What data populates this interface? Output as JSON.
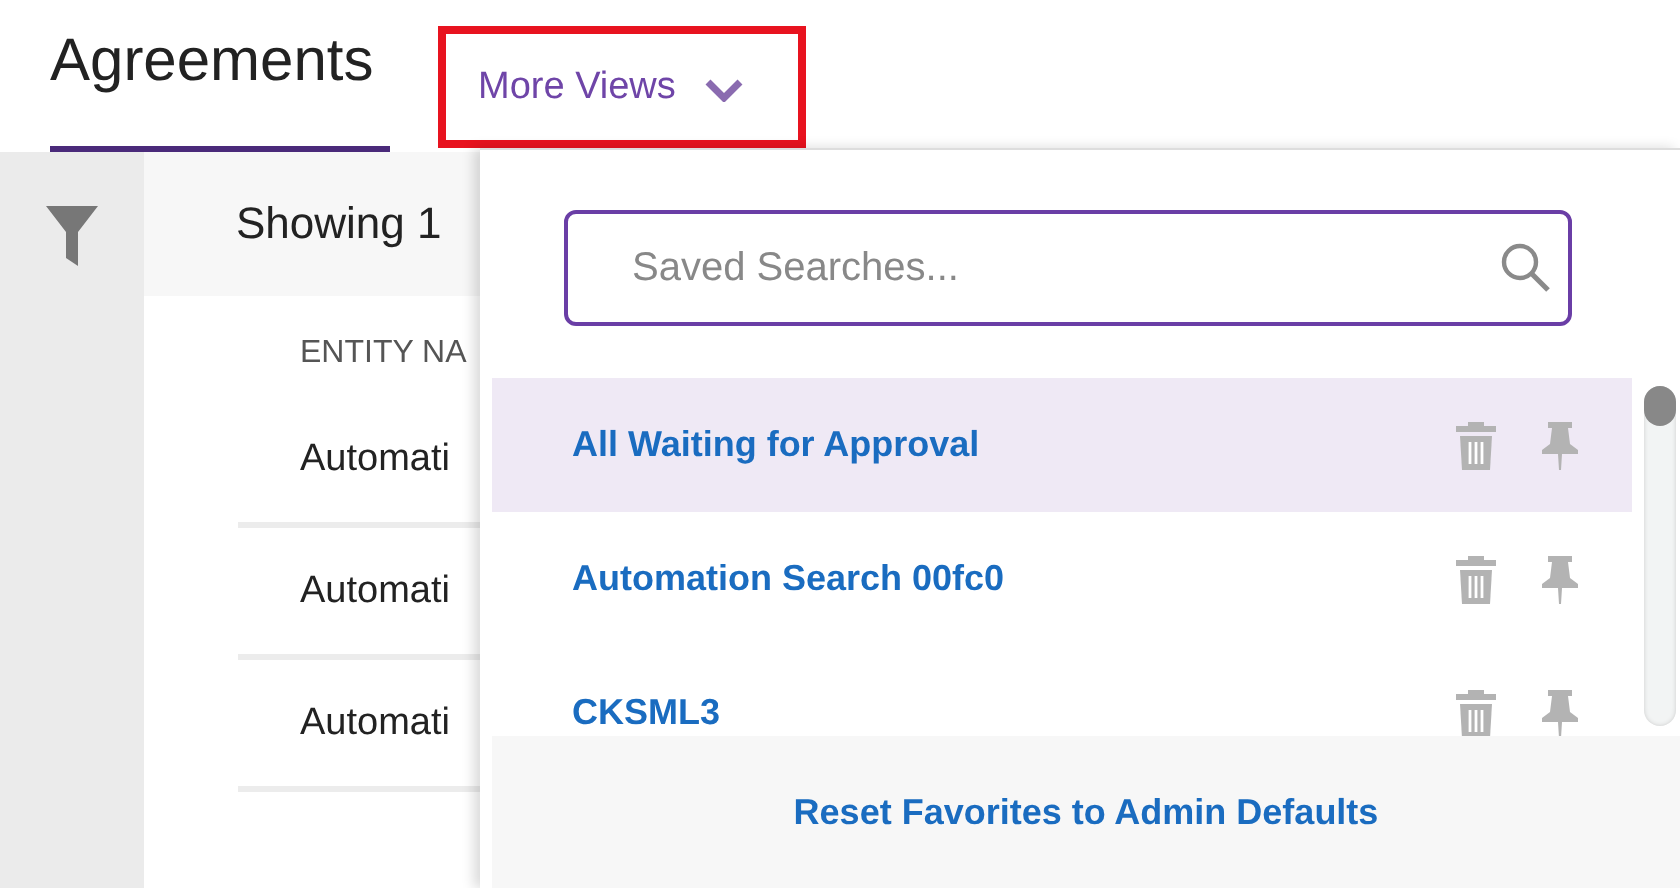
{
  "header": {
    "tabs": [
      {
        "label": "Agreements",
        "selected": true
      }
    ],
    "more_views": {
      "label": "More Views",
      "highlighted": true
    }
  },
  "results": {
    "summary": "Showing 1",
    "columns": [
      "ENTITY NA"
    ],
    "rows": [
      "Automati",
      "Automati",
      "Automati"
    ]
  },
  "dropdown": {
    "search": {
      "placeholder": "Saved Searches..."
    },
    "items": [
      {
        "label": "All Waiting for Approval",
        "selected": true
      },
      {
        "label": "Automation Search 00fc0",
        "selected": false
      },
      {
        "label": "CKSML3",
        "selected": false
      }
    ],
    "footer_link": "Reset Favorites to Admin Defaults"
  }
}
